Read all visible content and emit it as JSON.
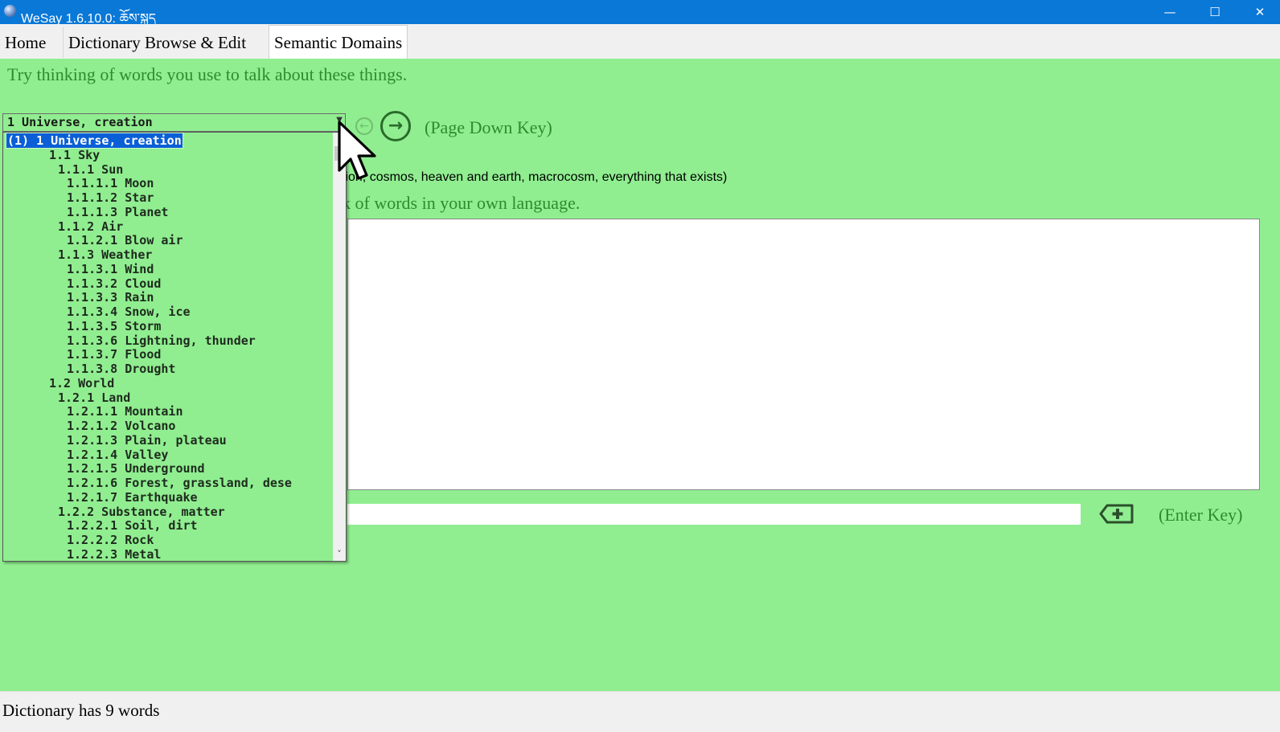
{
  "window": {
    "title": "WeSay 1.6.10.0: ཆོས་སྐད",
    "minimize_glyph": "—",
    "maximize_glyph": "☐",
    "close_glyph": "✕"
  },
  "tabs": [
    {
      "label": "Home"
    },
    {
      "label": "Dictionary Browse & Edit"
    },
    {
      "label": "Semantic Domains",
      "selected": true
    }
  ],
  "main": {
    "prompt": "Try thinking of words you use to talk about these things.",
    "nav_prev_glyph": "←",
    "nav_next_glyph": "→",
    "page_down_hint": "(Page Down Key)",
    "domain_description_visible": "tion, cosmos, heaven and earth, macrocosm, everything that exists)",
    "think_prompt_visible": "k of words in your own language.",
    "word_input_value": "",
    "enter_key_hint": "(Enter Key)"
  },
  "domain_combo": {
    "selected": "1 Universe, creation",
    "arrow_glyph": "▼"
  },
  "domain_list": [
    {
      "text": "(1) 1 Universe, creation",
      "level": 0,
      "selected": true
    },
    {
      "text": "1.1 Sky",
      "level": 1
    },
    {
      "text": "1.1.1 Sun",
      "level": 2
    },
    {
      "text": "1.1.1.1 Moon",
      "level": 3
    },
    {
      "text": "1.1.1.2 Star",
      "level": 3
    },
    {
      "text": "1.1.1.3 Planet",
      "level": 3
    },
    {
      "text": "1.1.2 Air",
      "level": 2
    },
    {
      "text": "1.1.2.1 Blow air",
      "level": 3
    },
    {
      "text": "1.1.3 Weather",
      "level": 2
    },
    {
      "text": "1.1.3.1 Wind",
      "level": 3
    },
    {
      "text": "1.1.3.2 Cloud",
      "level": 3
    },
    {
      "text": "1.1.3.3 Rain",
      "level": 3
    },
    {
      "text": "1.1.3.4 Snow, ice",
      "level": 3
    },
    {
      "text": "1.1.3.5 Storm",
      "level": 3
    },
    {
      "text": "1.1.3.6 Lightning, thunder",
      "level": 3
    },
    {
      "text": "1.1.3.7 Flood",
      "level": 3
    },
    {
      "text": "1.1.3.8 Drought",
      "level": 3
    },
    {
      "text": "1.2 World",
      "level": 1
    },
    {
      "text": "1.2.1 Land",
      "level": 2
    },
    {
      "text": "1.2.1.1 Mountain",
      "level": 3
    },
    {
      "text": "1.2.1.2 Volcano",
      "level": 3
    },
    {
      "text": "1.2.1.3 Plain, plateau",
      "level": 3
    },
    {
      "text": "1.2.1.4 Valley",
      "level": 3
    },
    {
      "text": "1.2.1.5 Underground",
      "level": 3
    },
    {
      "text": "1.2.1.6 Forest, grassland, dese",
      "level": 3
    },
    {
      "text": "1.2.1.7 Earthquake",
      "level": 3
    },
    {
      "text": "1.2.2 Substance, matter",
      "level": 2
    },
    {
      "text": "1.2.2.1 Soil, dirt",
      "level": 3
    },
    {
      "text": "1.2.2.2 Rock",
      "level": 3
    },
    {
      "text": "1.2.2.3 Metal",
      "level": 3
    }
  ],
  "scrollbar": {
    "up_glyph": "˄",
    "down_glyph": "˅"
  },
  "status": {
    "text": "Dictionary has 9 words"
  },
  "colors": {
    "titlebar": "#0a78d7",
    "panel": "#90ee90",
    "prompt_text": "#2e8b2e",
    "selection": "#0a5fd7"
  }
}
